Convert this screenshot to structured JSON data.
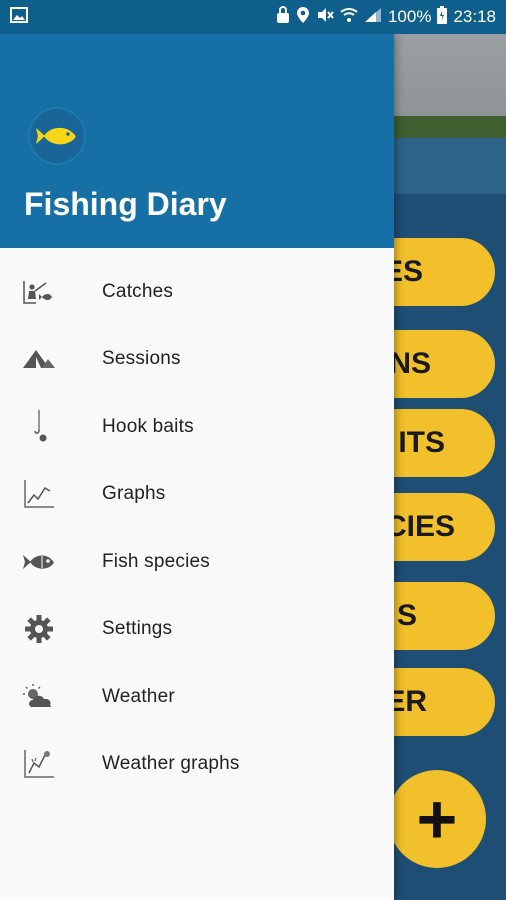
{
  "status_bar": {
    "battery": "100%",
    "time": "23:18",
    "icons": [
      "image-icon",
      "lock-icon",
      "location-icon",
      "mute-icon",
      "wifi-icon",
      "signal-icon",
      "battery-icon"
    ]
  },
  "drawer": {
    "app_title": "Fishing Diary",
    "logo_icon": "fish-logo-icon",
    "items": [
      {
        "label": "Catches",
        "icon": "fisherman-icon"
      },
      {
        "label": "Sessions",
        "icon": "tent-icon"
      },
      {
        "label": "Hook baits",
        "icon": "hook-icon"
      },
      {
        "label": "Graphs",
        "icon": "line-chart-icon"
      },
      {
        "label": "Fish species",
        "icon": "fish-icon"
      },
      {
        "label": "Settings",
        "icon": "gear-icon"
      },
      {
        "label": "Weather",
        "icon": "weather-icon"
      },
      {
        "label": "Weather graphs",
        "icon": "weather-graph-icon"
      }
    ]
  },
  "background": {
    "buttons": [
      "ES",
      "NS",
      "ITS",
      "CIES",
      "S",
      "ER"
    ],
    "fab_label": "+"
  },
  "colors": {
    "header": "#1770a5",
    "status_bar": "#0f5f8c",
    "accent": "#f1c02a"
  }
}
